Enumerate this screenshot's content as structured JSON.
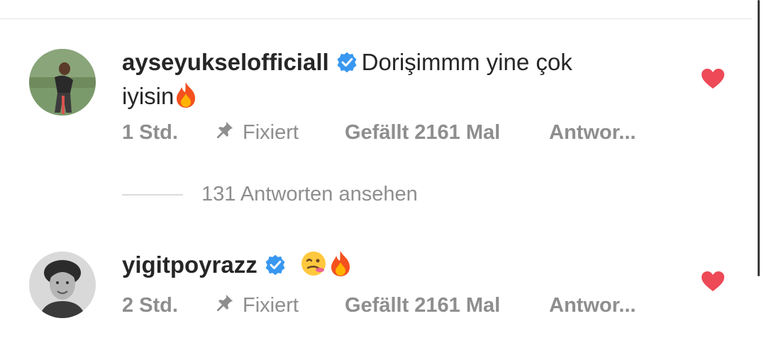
{
  "comments": [
    {
      "username": "ayseyukselofficiall",
      "text_part1": "Dorişimmm yine çok",
      "text_part2": "iyisin",
      "emojis": [
        "fire-emoji"
      ],
      "time": "1 Std.",
      "pinned_label": "Fixiert",
      "likes": "Gefällt 2161 Mal",
      "reply_label": "Antwor...",
      "verified": true,
      "liked": true
    },
    {
      "username": "yigitpoyrazz",
      "text_part1": "",
      "text_part2": "",
      "emojis": [
        "woozy-face-emoji",
        "fire-emoji"
      ],
      "time": "2 Std.",
      "pinned_label": "Fixiert",
      "likes": "Gefällt 2161 Mal",
      "reply_label": "Antwor...",
      "verified": true,
      "liked": true
    }
  ],
  "replies_toggle": "131 Antworten ansehen",
  "colors": {
    "heart": "#ed4956",
    "verified": "#3897f0",
    "muted_text": "#8e8e8e"
  }
}
